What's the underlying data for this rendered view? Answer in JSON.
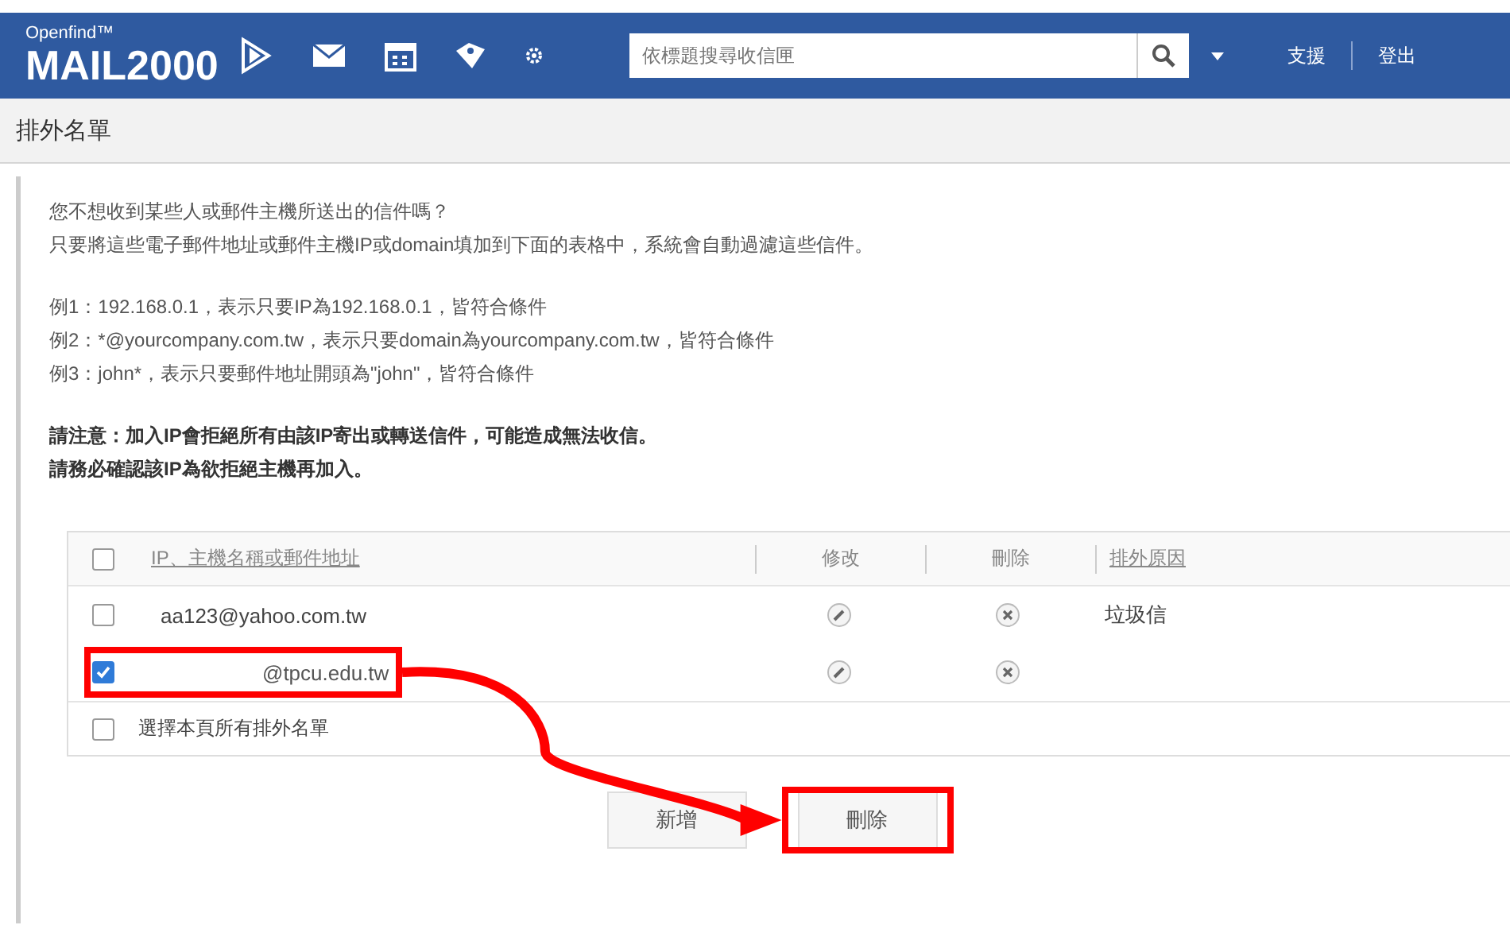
{
  "header": {
    "brand_top": "Openfind™",
    "brand": "MAIL2000",
    "search": {
      "placeholder": "依標題搜尋收信匣"
    },
    "links": [
      "支援",
      "登出"
    ]
  },
  "page_title": "排外名單",
  "intro": [
    "您不想收到某些人或郵件主機所送出的信件嗎？",
    "只要將這些電子郵件地址或郵件主機IP或domain填加到下面的表格中，系統會自動過濾這些信件。"
  ],
  "examples": [
    "例1：192.168.0.1，表示只要IP為192.168.0.1，皆符合條件",
    "例2：*@yourcompany.com.tw，表示只要domain為yourcompany.com.tw，皆符合條件",
    "例3：john*，表示只要郵件地址開頭為\"john\"，皆符合條件"
  ],
  "notice": [
    "請注意：加入IP會拒絕所有由該IP寄出或轉送信件，可能造成無法收信。",
    "請務必確認該IP為欲拒絕主機再加入。"
  ],
  "table": {
    "header_checked": false,
    "columns": [
      "IP、主機名稱或郵件地址",
      "修改",
      "刪除",
      "排外原因"
    ],
    "rows": [
      {
        "address": "aa123@yahoo.com.tw",
        "reason": "垃圾信",
        "checked": false,
        "redacted": false,
        "highlighted": false
      },
      {
        "address": "@tpcu.edu.tw",
        "checked": true,
        "redacted": true,
        "highlighted": true
      }
    ],
    "select_all": {
      "label": "選擇本頁所有排外名單",
      "checked": false
    }
  },
  "buttons": [
    {
      "label": "新增",
      "highlighted": false
    },
    {
      "label": "刪除",
      "highlighted": true
    }
  ]
}
